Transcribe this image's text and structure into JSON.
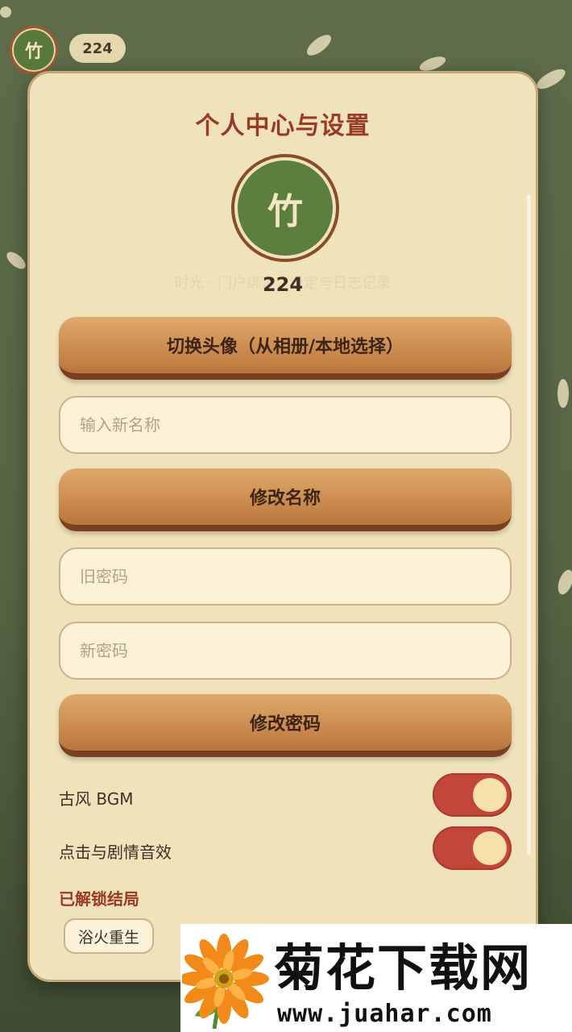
{
  "header": {
    "avatar_char": "竹",
    "score": "224"
  },
  "panel": {
    "title": "个人中心与设置",
    "faint_text": "时光 · 门户绑定 · 设定与日志记录",
    "avatar_char": "竹",
    "score": "224",
    "change_avatar_label": "切换头像（从相册/本地选择）",
    "name_placeholder": "输入新名称",
    "rename_label": "修改名称",
    "old_password_placeholder": "旧密码",
    "new_password_placeholder": "新密码",
    "change_password_label": "修改密码",
    "toggles": [
      {
        "label": "古风 BGM",
        "on": true
      },
      {
        "label": "点击与剧情音效",
        "on": true
      }
    ],
    "endings_title": "已解锁结局",
    "endings": [
      "浴火重生"
    ]
  },
  "colors": {
    "accent": "#9b3a24",
    "button": "#cb8a4d",
    "toggle_on": "#c2473a",
    "avatar_green": "#5c7f3e"
  },
  "watermark": {
    "title": "菊花下载网",
    "url": "www.juahar.com"
  }
}
